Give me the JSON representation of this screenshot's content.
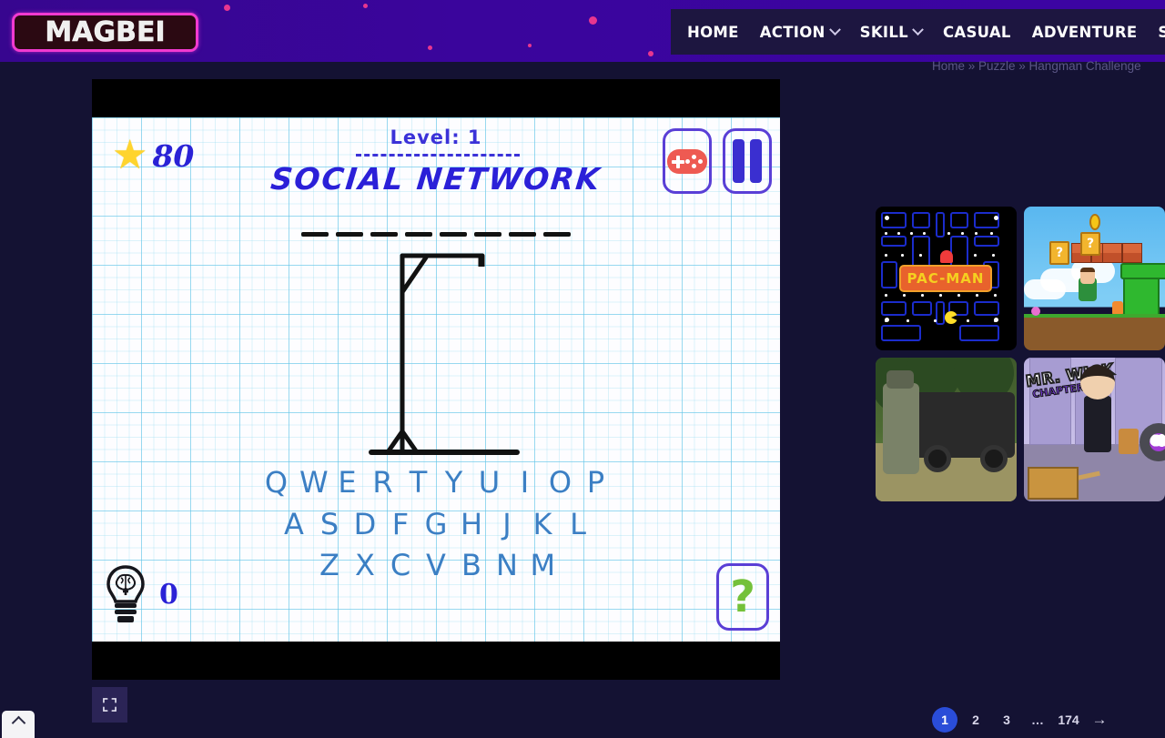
{
  "header": {
    "logo_text": "MAGBEI",
    "nav": [
      {
        "label": "HOME",
        "has_dropdown": false
      },
      {
        "label": "ACTION",
        "has_dropdown": true
      },
      {
        "label": "SKILL",
        "has_dropdown": true
      },
      {
        "label": "CASUAL",
        "has_dropdown": false
      },
      {
        "label": "ADVENTURE",
        "has_dropdown": false
      },
      {
        "label": "SPORTS",
        "has_dropdown": false
      }
    ],
    "accent_purple": "#3c04a3",
    "logo_border": "#f13ad0",
    "nav_bg": "#1d1640"
  },
  "breadcrumb": {
    "text": "Home » Puzzle » Hangman Challenge",
    "items": [
      "Home",
      "Puzzle",
      "Hangman Challenge"
    ],
    "separator": "»"
  },
  "game": {
    "title": "Hangman Challenge",
    "score_value": "80",
    "score_icon": "star-icon",
    "level_label": "Level: 1",
    "category": "SOCIAL NETWORK",
    "word_blank_count": 8,
    "hint_count": "0",
    "hint_icon": "lightbulb-brain-icon",
    "help_label": "?",
    "buttons": {
      "gamepad": "gamepad-icon",
      "pause": "pause-icon",
      "fullscreen": "fullscreen-icon"
    },
    "keyboard": {
      "row1": [
        "Q",
        "W",
        "E",
        "R",
        "T",
        "Y",
        "U",
        "I",
        "O",
        "P"
      ],
      "row2": [
        "A",
        "S",
        "D",
        "F",
        "G",
        "H",
        "J",
        "K",
        "L"
      ],
      "row3": [
        "Z",
        "X",
        "C",
        "V",
        "B",
        "N",
        "M"
      ]
    },
    "colors": {
      "ink_blue": "#2b20d8",
      "key_blue": "#3b7fc4",
      "star_yellow": "#ffd42e",
      "gamepad_red": "#ee5a52",
      "help_green": "#74c13a",
      "outline_purple": "#5a3fd6"
    }
  },
  "thumbnails": [
    {
      "name": "Pac-Man",
      "logo_text": "PAC-MAN",
      "kind": "pacman-thumbnail"
    },
    {
      "name": "Platformer",
      "logo_text": "?",
      "kind": "mario-thumbnail"
    },
    {
      "name": "Military Shooter",
      "logo_text": "",
      "kind": "soldier-thumbnail"
    },
    {
      "name": "Mr. Wick Chapter One",
      "title_line1": "MR. WICK",
      "title_line2": "CHAPTER ONE",
      "kind": "wick-thumbnail"
    }
  ],
  "pagination": {
    "pages": [
      "1",
      "2",
      "3",
      "…",
      "174"
    ],
    "active": "1",
    "next_arrow": "→"
  },
  "scroll_top": {
    "icon": "chevron-up-icon"
  }
}
